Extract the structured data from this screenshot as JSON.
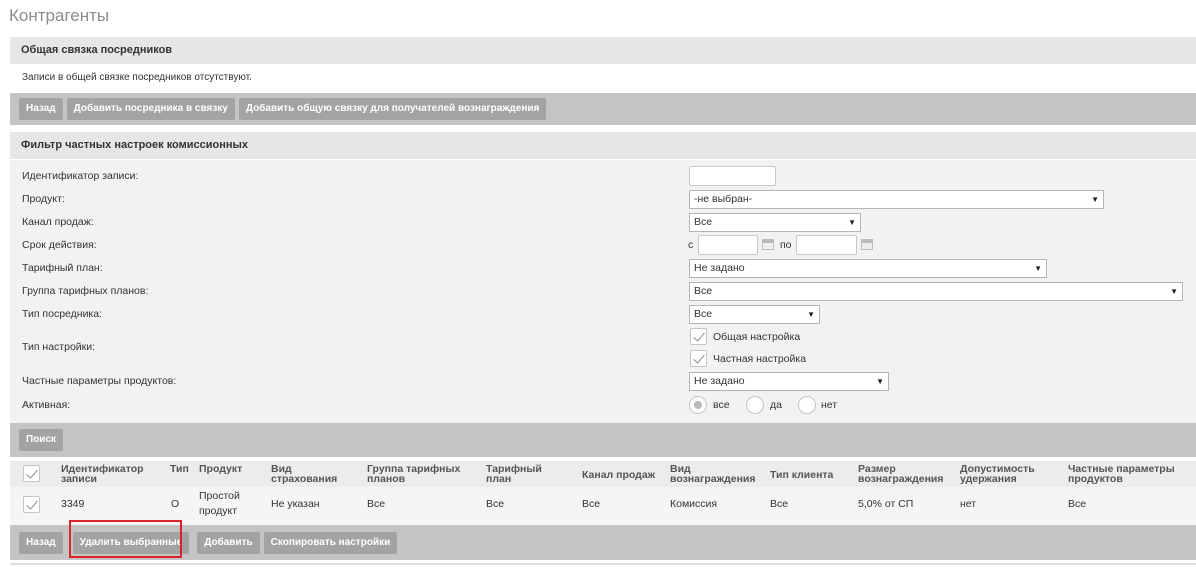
{
  "page": {
    "title": "Контрагенты"
  },
  "common_link": {
    "header": "Общая связка посредников",
    "info": "Записи в общей связке посредников отсутствуют.",
    "buttons": {
      "back": "Назад",
      "add_intermediary": "Добавить посредника в связку",
      "add_common_link": "Добавить общую связку для получателей вознаграждения"
    }
  },
  "filter": {
    "header": "Фильтр частных настроек комиссионных",
    "labels": {
      "record_id": "Идентификатор записи:",
      "product": "Продукт:",
      "sales_channel": "Канал продаж:",
      "validity": "Срок действия:",
      "tariff_plan": "Тарифный план:",
      "tariff_group": "Группа тарифных планов:",
      "intermediary_type": "Тип посредника:",
      "setting_type": "Тип настройки:",
      "private_params": "Частные параметры продуктов:",
      "active": "Активная:"
    },
    "values": {
      "record_id": "",
      "product": "-не выбран-",
      "sales_channel": "Все",
      "validity_from_label": "с",
      "validity_to_label": "по",
      "validity_from": "",
      "validity_to": "",
      "tariff_plan": "Не задано",
      "tariff_group": "Все",
      "intermediary_type": "Все",
      "setting_common": "Общая настройка",
      "setting_private": "Частная настройка",
      "private_params": "Не задано",
      "active_all": "все",
      "active_yes": "да",
      "active_no": "нет"
    },
    "search_button": "Поиск"
  },
  "table": {
    "headers": {
      "record_id": "Идентификатор записи",
      "type": "Тип",
      "product": "Продукт",
      "insurance_type": "Вид страхования",
      "tariff_group": "Группа тарифных планов",
      "tariff_plan": "Тарифный план",
      "sales_channel": "Канал продаж",
      "reward_type": "Вид вознаграждения",
      "client_type": "Тип клиента",
      "reward_size": "Размер вознаграждения",
      "retention": "Допустимость удержания",
      "private_params": "Частные параметры продуктов"
    },
    "rows": [
      {
        "record_id": "3349",
        "type": "О",
        "product": "Простой продукт",
        "insurance_type": "Не указан",
        "tariff_group": "Все",
        "tariff_plan": "Все",
        "sales_channel": "Все",
        "reward_type": "Комиссия",
        "client_type": "Все",
        "reward_size": "5,0% от СП",
        "retention": "нет",
        "private_params": "Все"
      }
    ]
  },
  "actions": {
    "back": "Назад",
    "delete_selected": "Удалить выбранные",
    "add": "Добавить",
    "copy_settings": "Скопировать настройки"
  },
  "colors": {
    "highlight": "#d9232d",
    "button_bg": "#a3a3a3",
    "bar_bg": "#c4c4c4"
  }
}
